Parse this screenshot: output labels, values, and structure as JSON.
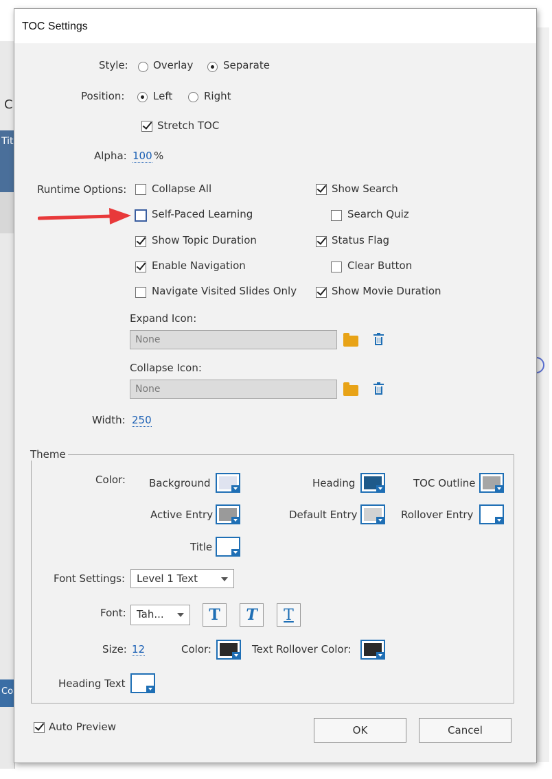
{
  "window": {
    "title": "TOC Settings"
  },
  "background": {
    "left_texts": [
      "C",
      "Titl",
      "Co"
    ]
  },
  "style_row": {
    "label": "Style:",
    "options": [
      "Overlay",
      "Separate"
    ],
    "selected": "Separate"
  },
  "position_row": {
    "label": "Position:",
    "options": [
      "Left",
      "Right"
    ],
    "selected": "Left"
  },
  "stretch_toc": {
    "label": "Stretch TOC",
    "checked": true
  },
  "alpha": {
    "label": "Alpha:",
    "value": "100",
    "unit": "%"
  },
  "runtime": {
    "label": "Runtime Options:",
    "left": [
      {
        "label": "Collapse All",
        "checked": false
      },
      {
        "label": "Self-Paced Learning",
        "checked": false,
        "highlighted": true
      },
      {
        "label": "Show Topic Duration",
        "checked": true
      },
      {
        "label": "Enable Navigation",
        "checked": true
      },
      {
        "label": "Navigate Visited Slides Only",
        "checked": false
      }
    ],
    "right": [
      {
        "label": "Show Search",
        "checked": true
      },
      {
        "label": "Search Quiz",
        "checked": false
      },
      {
        "label": "Status Flag",
        "checked": true
      },
      {
        "label": "Clear Button",
        "checked": false
      },
      {
        "label": "Show Movie Duration",
        "checked": true
      }
    ]
  },
  "expand_icon": {
    "label": "Expand Icon:",
    "value": "None"
  },
  "collapse_icon": {
    "label": "Collapse Icon:",
    "value": "None"
  },
  "width": {
    "label": "Width:",
    "value": "250"
  },
  "theme": {
    "legend": "Theme",
    "color_label": "Color:",
    "swatches": {
      "background": {
        "label": "Background",
        "color": "#dfe3f0"
      },
      "heading": {
        "label": "Heading",
        "color": "#1f5a8a"
      },
      "toc_outline": {
        "label": "TOC Outline",
        "color": "#a6a6a6"
      },
      "active_entry": {
        "label": "Active Entry",
        "color": "#9a9a9a"
      },
      "default_entry": {
        "label": "Default Entry",
        "color": "#d2d2d2"
      },
      "rollover_entry": {
        "label": "Rollover Entry",
        "color": "#ffffff"
      },
      "title": {
        "label": "Title",
        "color": "#ffffff"
      }
    },
    "font_settings": {
      "label": "Font Settings:",
      "value": "Level 1 Text"
    },
    "font": {
      "label": "Font:",
      "value": "Tah..."
    },
    "style_buttons": [
      "T",
      "T",
      "T"
    ],
    "size": {
      "label": "Size:",
      "value": "12"
    },
    "text_color": {
      "label": "Color:",
      "color": "#2a2a2a"
    },
    "text_rollover_color": {
      "label": "Text Rollover Color:",
      "color": "#2a2a2a"
    },
    "heading_text": {
      "label": "Heading Text",
      "color": "#ffffff"
    }
  },
  "auto_preview": {
    "label": "Auto Preview",
    "checked": true
  },
  "buttons": {
    "ok": "OK",
    "cancel": "Cancel"
  },
  "colors": {
    "accent": "#1f6fb5",
    "annotation_arrow": "#e8393a"
  }
}
